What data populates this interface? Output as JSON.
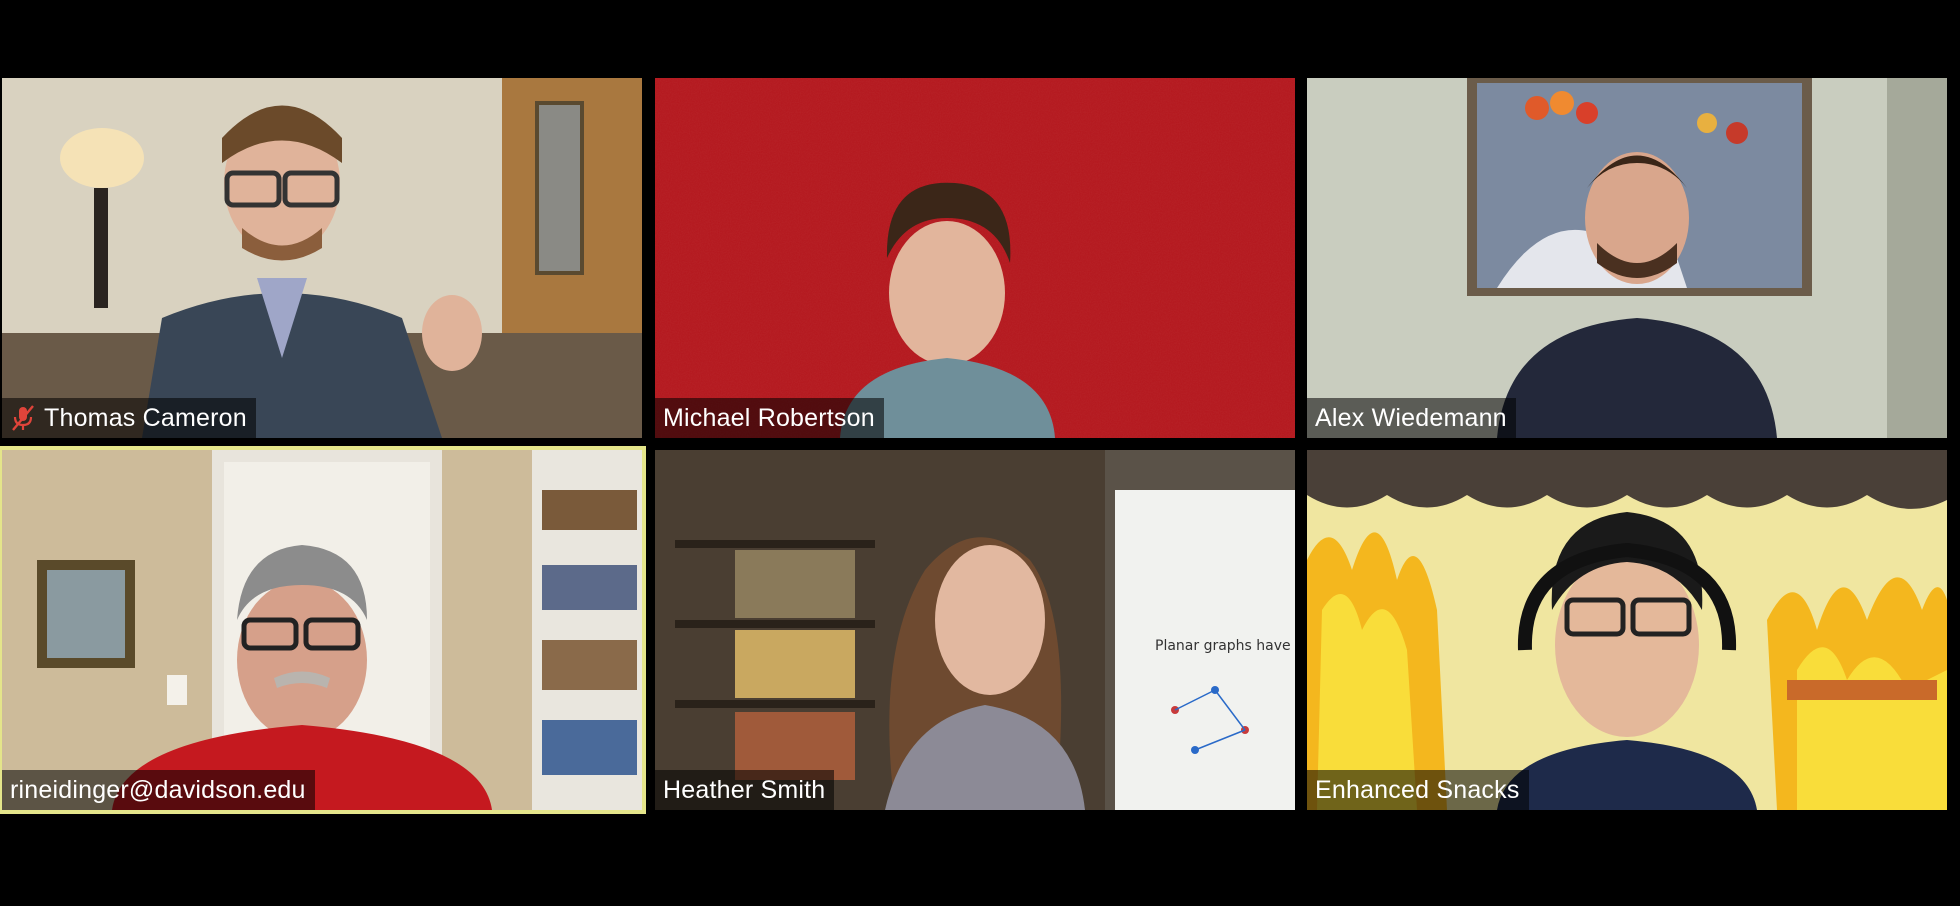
{
  "meeting": {
    "layout": "gallery-view",
    "active_speaker_border_color": "#e4e58a",
    "muted_icon_color": "#e0443a"
  },
  "participants": [
    {
      "name": "Thomas Cameron",
      "muted": true,
      "active_speaker": false,
      "background": "office-with-lamp"
    },
    {
      "name": "Michael Robertson",
      "muted": false,
      "active_speaker": false,
      "background": "red-textured"
    },
    {
      "name": "Alex Wiedemann",
      "muted": false,
      "active_speaker": false,
      "background": "still-life-painting"
    },
    {
      "name": "rineidinger@davidson.edu",
      "muted": false,
      "active_speaker": true,
      "background": "door-and-bookshelf"
    },
    {
      "name": "Heather Smith",
      "muted": false,
      "active_speaker": false,
      "background": "bookshelf-and-whiteboard"
    },
    {
      "name": "Enhanced Snacks",
      "muted": false,
      "active_speaker": false,
      "background": "this-is-fine-fire"
    }
  ],
  "whiteboard_text": "Planar graphs have chromatic number"
}
